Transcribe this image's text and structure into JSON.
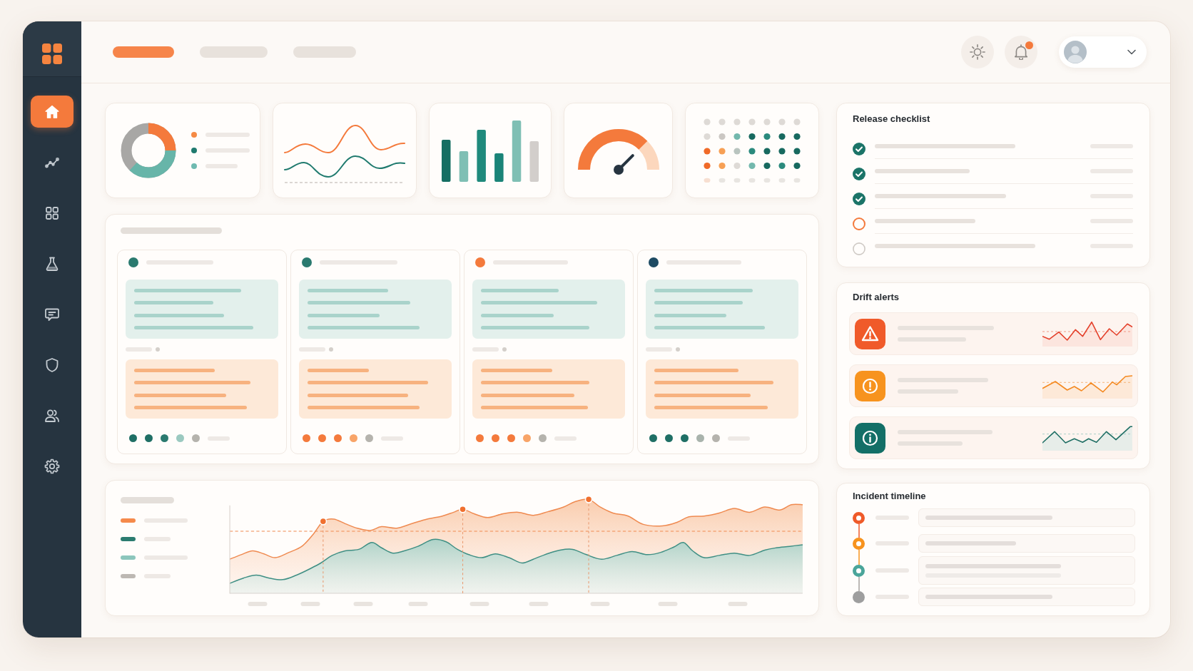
{
  "sidebar": {
    "items": [
      {
        "selected": true
      },
      {
        "selected": false
      },
      {
        "selected": false
      },
      {
        "selected": false
      },
      {
        "selected": false
      },
      {
        "selected": false
      },
      {
        "selected": false
      },
      {
        "selected": false
      }
    ]
  },
  "topbar": {
    "tabs": [
      {
        "selected": true
      },
      {
        "selected": false
      },
      {
        "selected": false
      }
    ],
    "notifications": {
      "unread": true
    }
  },
  "donut_legend": [
    {
      "color": "#f58a45"
    },
    {
      "color": "#1f7a6e"
    },
    {
      "color": "#6fbab0"
    }
  ],
  "board": {
    "columns": [
      {
        "color": "#2a7a6f",
        "dots": [
          {
            "color": "#1f6f65"
          },
          {
            "color": "#1f6f65"
          },
          {
            "color": "#2a7a6f"
          },
          {
            "color": "#9bc9c0"
          },
          {
            "color": "#b5b3ad"
          }
        ]
      },
      {
        "color": "#2a7a6f",
        "dots": [
          {
            "color": "#f47a3c"
          },
          {
            "color": "#f47a3c"
          },
          {
            "color": "#f47a3c"
          },
          {
            "color": "#f8a468"
          },
          {
            "color": "#b5b3ad"
          }
        ]
      },
      {
        "color": "#f47a3c",
        "dots": [
          {
            "color": "#f47a3c"
          },
          {
            "color": "#f47a3c"
          },
          {
            "color": "#f47a3c"
          },
          {
            "color": "#f8a468"
          },
          {
            "color": "#b5b3ad"
          }
        ]
      },
      {
        "color": "#1d4b63",
        "dots": [
          {
            "color": "#1f6f65"
          },
          {
            "color": "#1f6f65"
          },
          {
            "color": "#1f6f65"
          },
          {
            "color": "#a9b3ac"
          },
          {
            "color": "#b5b3ad"
          }
        ]
      }
    ]
  },
  "trend_legend": [
    {
      "color": "#f58a4b"
    },
    {
      "color": "#2b7c70"
    },
    {
      "color": "#8cc6bc"
    },
    {
      "color": "#bdb8b3"
    }
  ],
  "release_checklist": {
    "title": "Release checklist",
    "items": [
      {
        "kind": "done"
      },
      {
        "kind": "done"
      },
      {
        "kind": "done"
      },
      {
        "kind": "current"
      },
      {
        "kind": "todo"
      }
    ]
  },
  "drift_alerts": {
    "title": "Drift alerts",
    "items": [
      {
        "kind": "critical"
      },
      {
        "kind": "warning"
      },
      {
        "kind": "info"
      }
    ]
  },
  "incident_timeline": {
    "title": "Incident timeline",
    "items": [
      {
        "kind": "event",
        "color": "#ef5a29"
      },
      {
        "kind": "event",
        "color": "#f7931e"
      },
      {
        "kind": "event",
        "color": "#4aa59a"
      },
      {
        "kind": "pending",
        "color": "#9e9e9e"
      }
    ]
  }
}
